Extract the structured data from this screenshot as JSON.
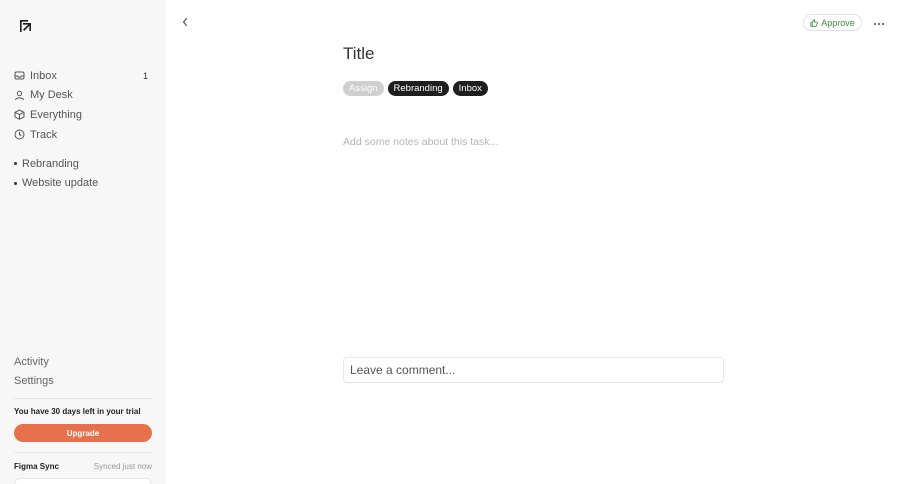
{
  "sidebar": {
    "nav": [
      {
        "label": "Inbox",
        "icon": "inbox-icon",
        "count": "1"
      },
      {
        "label": "My Desk",
        "icon": "user-icon",
        "count": ""
      },
      {
        "label": "Everything",
        "icon": "box-icon",
        "count": ""
      },
      {
        "label": "Track",
        "icon": "clock-icon",
        "count": ""
      }
    ],
    "projects": [
      "Rebranding",
      "Website update"
    ],
    "bottom_links": [
      "Activity",
      "Settings"
    ],
    "trial_text": "You have 30 days left in your trial",
    "upgrade_label": "Upgrade",
    "sync_title": "Figma Sync",
    "sync_status": "Synced just now"
  },
  "task": {
    "approve_label": "Approve",
    "title": "Title",
    "tags": [
      "Assign",
      "Rebranding",
      "Inbox"
    ],
    "notes_placeholder": "Add some notes about this task...",
    "comment_placeholder": "Leave a comment..."
  },
  "colors": {
    "accent": "#e8714d",
    "approve": "#3f8a3a",
    "tag_dark": "#1f1f1f",
    "tag_muted": "#cfcfcf"
  }
}
